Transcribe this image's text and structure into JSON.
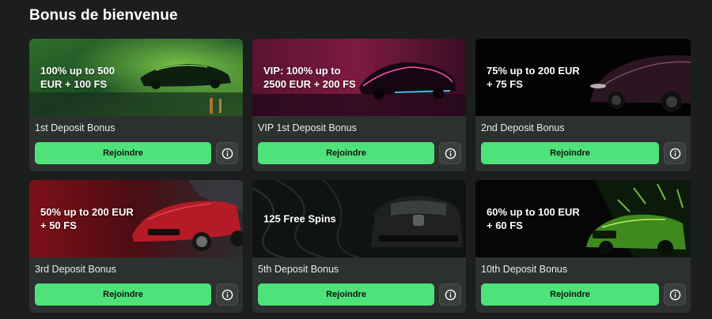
{
  "section": {
    "title": "Bonus de bienvenue"
  },
  "colors": {
    "accent": "#4fe27a",
    "card_bg": "#2c302f",
    "page_bg": "#1b1e1d"
  },
  "cards": [
    {
      "banner_line1": "100% up to 500",
      "banner_line2": "EUR + 100 FS",
      "label": "1st Deposit Bonus",
      "button": "Rejoindre",
      "info_icon": "info-icon",
      "theme": "green-lambo"
    },
    {
      "banner_line1": "VIP: 100% up to",
      "banner_line2": "2500 EUR + 200 FS",
      "label": "VIP 1st Deposit Bonus",
      "button": "Rejoindre",
      "info_icon": "info-icon",
      "theme": "magenta-hypercar"
    },
    {
      "banner_line1": "75% up to 200 EUR",
      "banner_line2": "+ 75 FS",
      "label": "2nd Deposit Bonus",
      "button": "Rejoindre",
      "info_icon": "info-icon",
      "theme": "black-nissan"
    },
    {
      "banner_line1": "50% up to 200 EUR",
      "banner_line2": "+ 50 FS",
      "label": "3rd Deposit Bonus",
      "button": "Rejoindre",
      "info_icon": "info-icon",
      "theme": "red-audi"
    },
    {
      "banner_line1": "125 Free Spins",
      "banner_line2": "",
      "label": "5th Deposit Bonus",
      "button": "Rejoindre",
      "info_icon": "info-icon",
      "theme": "dark-bugatti"
    },
    {
      "banner_line1": "60% up to 100 EUR",
      "banner_line2": "+ 60 FS",
      "label": "10th Deposit Bonus",
      "button": "Rejoindre",
      "info_icon": "info-icon",
      "theme": "neon-bugatti"
    }
  ]
}
